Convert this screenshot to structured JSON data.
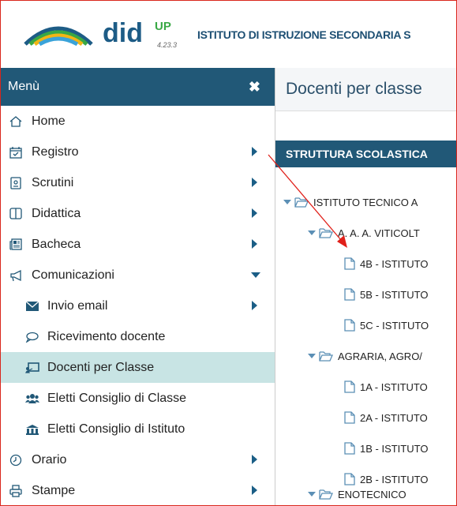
{
  "header": {
    "brand": "did",
    "brand_sup": "UP",
    "version": "4.23.3",
    "school": "ISTITUTO DI ISTRUZIONE SECONDARIA S"
  },
  "sidebar": {
    "menu_title": "Menù",
    "close_glyph": "✖",
    "items": [
      {
        "label": "Home",
        "icon": "home-icon"
      },
      {
        "label": "Registro",
        "icon": "calendar-icon"
      },
      {
        "label": "Scrutini",
        "icon": "scrutini-icon"
      },
      {
        "label": "Didattica",
        "icon": "book-icon"
      },
      {
        "label": "Bacheca",
        "icon": "newspaper-icon"
      },
      {
        "label": "Comunicazioni",
        "icon": "megaphone-icon"
      },
      {
        "label": "Invio email",
        "icon": "envelope-icon"
      },
      {
        "label": "Ricevimento docente",
        "icon": "chat-icon"
      },
      {
        "label": "Docenti per Classe",
        "icon": "chalkboard-icon"
      },
      {
        "label": "Eletti Consiglio di Classe",
        "icon": "users-icon"
      },
      {
        "label": "Eletti Consiglio di Istituto",
        "icon": "institute-icon"
      },
      {
        "label": "Orario",
        "icon": "clock-icon"
      },
      {
        "label": "Stampe",
        "icon": "printer-icon"
      }
    ]
  },
  "main": {
    "title": "Docenti per classe",
    "structure_header": "STRUTTURA SCOLASTICA",
    "tree": [
      {
        "label": "ISTITUTO TECNICO A",
        "type": "folder"
      },
      {
        "label": "A. A. A. VITICOLT",
        "type": "folder"
      },
      {
        "label": "4B - ISTITUTO",
        "type": "file"
      },
      {
        "label": "5B - ISTITUTO",
        "type": "file"
      },
      {
        "label": "5C - ISTITUTO",
        "type": "file"
      },
      {
        "label": "AGRARIA, AGRO/",
        "type": "folder"
      },
      {
        "label": "1A - ISTITUTO",
        "type": "file"
      },
      {
        "label": "2A - ISTITUTO",
        "type": "file"
      },
      {
        "label": "1B - ISTITUTO",
        "type": "file"
      },
      {
        "label": "2B - ISTITUTO",
        "type": "file"
      },
      {
        "label": "ENOTECNICO",
        "type": "folder"
      }
    ]
  },
  "colors": {
    "primary": "#215877",
    "active_row": "#c8e4e4",
    "annotation_arrow": "#e0201a"
  }
}
